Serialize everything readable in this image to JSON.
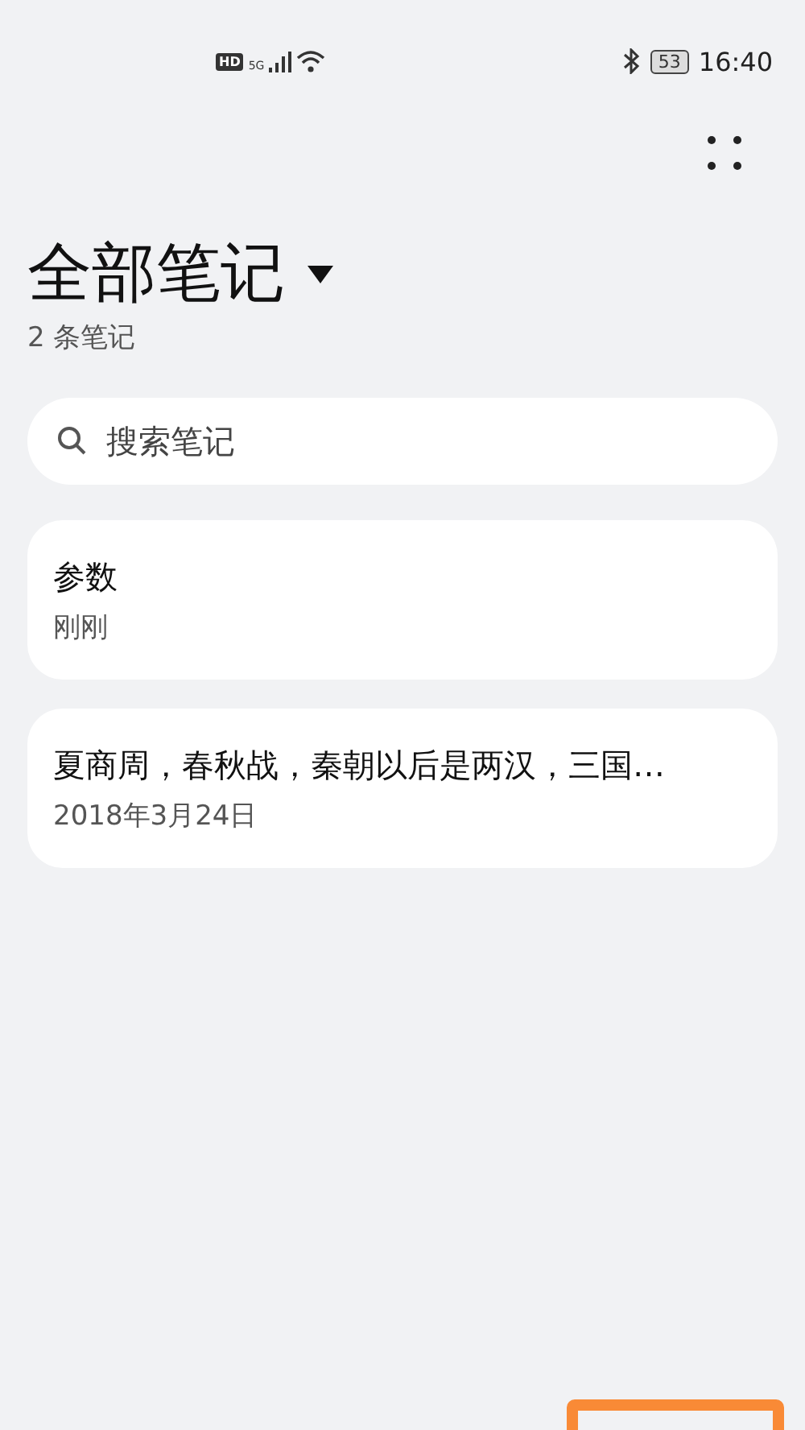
{
  "status_bar": {
    "hd": "HD",
    "network": "5G",
    "battery": "53",
    "time": "16:40"
  },
  "header": {
    "title": "全部笔记",
    "count": "2 条笔记"
  },
  "search": {
    "placeholder": "搜索笔记"
  },
  "notes": [
    {
      "title": "参数",
      "date": "刚刚"
    },
    {
      "title": "夏商周，春秋战，秦朝以后是两汉，三国…",
      "date": "2018年3月24日"
    }
  ]
}
